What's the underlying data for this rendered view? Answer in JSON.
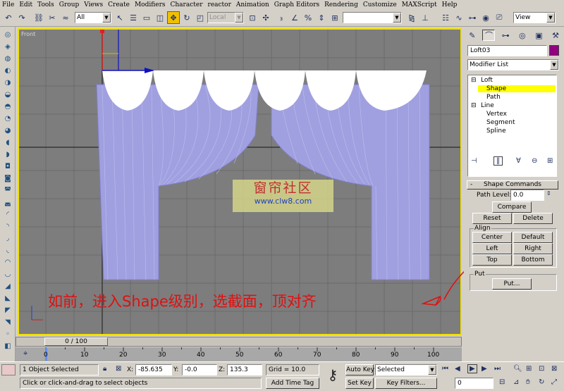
{
  "menu": [
    "File",
    "Edit",
    "Tools",
    "Group",
    "Views",
    "Create",
    "Modifiers",
    "Character",
    "reactor",
    "Animation",
    "Graph Editors",
    "Rendering",
    "Customize",
    "MAXScript",
    "Help"
  ],
  "toolbar": {
    "selection_filter": "All",
    "reference_coord": "Local",
    "named_selection": "",
    "view_dropdown": "View"
  },
  "viewport": {
    "label": "Front",
    "watermark_title": "窗帘社区",
    "watermark_url": "www.clw8.com",
    "instruction": "如前，进入Shape级别，选截面，顶对齐"
  },
  "time_slider": {
    "label": "0 / 100"
  },
  "timeline": {
    "ticks": [
      "0",
      "10",
      "20",
      "30",
      "40",
      "50",
      "60",
      "70",
      "80",
      "90",
      "100"
    ]
  },
  "status": {
    "selected": "1 Object Selected",
    "prompt": "Click or click-and-drag to select objects",
    "x_label": "X:",
    "x_value": "-85.635",
    "y_label": "Y:",
    "y_value": "-0.0",
    "z_label": "Z:",
    "z_value": "135.3",
    "grid": "Grid = 10.0",
    "add_time_tag": "Add Time Tag",
    "auto_key": "Auto Key",
    "set_key": "Set Key",
    "key_mode": "Selected",
    "key_filters": "Key Filters...",
    "frame": "0"
  },
  "command_panel": {
    "object_name": "Loft03",
    "object_color": "#900080",
    "modifier_list": "Modifier List",
    "stack": [
      {
        "toggle": "⊟",
        "label": "Loft"
      },
      {
        "toggle": "",
        "label": "Shape"
      },
      {
        "toggle": "",
        "label": "Path"
      },
      {
        "toggle": "⊟",
        "label": "Line"
      },
      {
        "toggle": "",
        "label": "Vertex"
      },
      {
        "toggle": "",
        "label": "Segment"
      },
      {
        "toggle": "",
        "label": "Spline"
      }
    ],
    "rollout_toggle": "-",
    "rollout_title": "Shape Commands",
    "path_level_label": "Path Level:",
    "path_level_value": "0.0",
    "compare": "Compare",
    "reset": "Reset",
    "delete": "Delete",
    "align_label": "Align",
    "center": "Center",
    "default": "Default",
    "left": "Left",
    "right": "Right",
    "top": "Top",
    "bottom": "Bottom",
    "put_label": "Put",
    "put_button": "Put..."
  },
  "colors": {
    "viewport_bg": "#7d7d7d",
    "curtain": "#a0a0e0",
    "valance": "#ffffff",
    "active_border": "#f0e000",
    "selection": "#ffff00",
    "annotation": "#e01010"
  },
  "icons": {
    "undo": "undo-icon",
    "redo": "redo-icon",
    "link": "link-icon",
    "unlink": "unlink-icon",
    "bind": "bind-space-warp-icon",
    "select": "select-icon",
    "select_name": "select-by-name-icon",
    "move": "move-icon",
    "rotate": "rotate-icon",
    "scale": "scale-icon"
  }
}
